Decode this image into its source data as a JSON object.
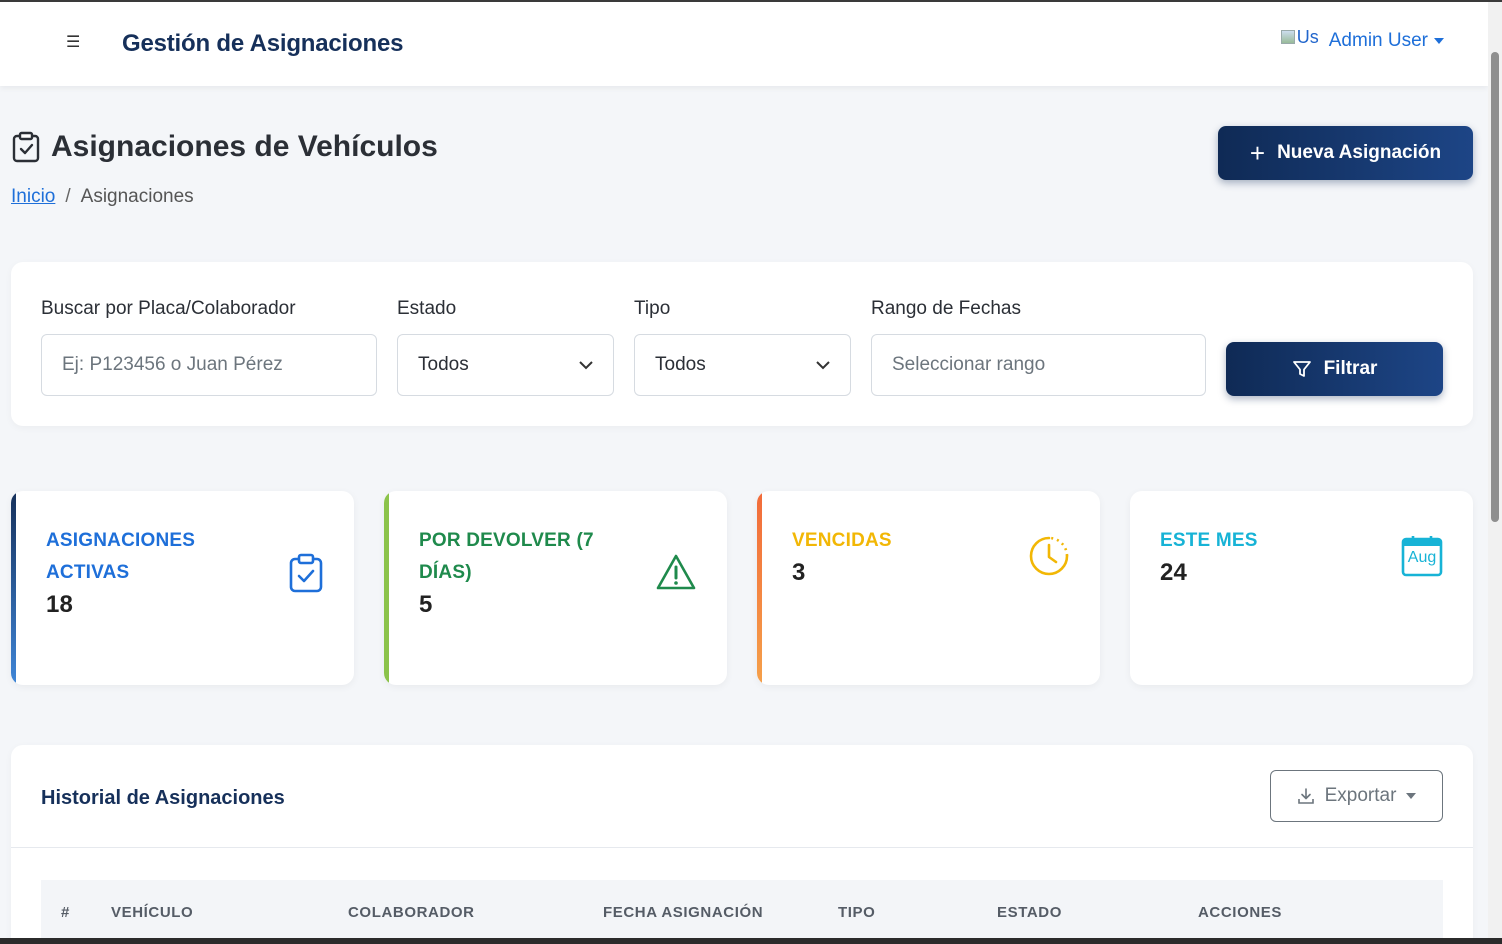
{
  "topbar": {
    "menu_icon": "hamburger-icon",
    "app_title": "Gestión de Asignaciones",
    "avatar_alt": "Us",
    "user_name": "Admin User"
  },
  "page": {
    "title": "Asignaciones de Vehículos",
    "title_icon": "clipboard-check-icon",
    "breadcrumb": {
      "home": "Inicio",
      "current": "Asignaciones"
    },
    "new_button": "Nueva Asignación"
  },
  "filters": {
    "search": {
      "label": "Buscar por Placa/Colaborador",
      "placeholder": "Ej: P123456 o Juan Pérez"
    },
    "estado": {
      "label": "Estado",
      "value": "Todos"
    },
    "tipo": {
      "label": "Tipo",
      "value": "Todos"
    },
    "fechas": {
      "label": "Rango de Fechas",
      "placeholder": "Seleccionar rango"
    },
    "filter_button": "Filtrar"
  },
  "stats": [
    {
      "label": "ASIGNACIONES ACTIVAS",
      "value": "18",
      "color": "#1e6fd9",
      "icon": "clipboard-check-icon"
    },
    {
      "label": "POR DEVOLVER (7 DÍAS)",
      "value": "5",
      "color": "#1f8a4c",
      "icon": "warning-triangle-icon"
    },
    {
      "label": "VENCIDAS",
      "value": "3",
      "color": "#f2b705",
      "icon": "clock-icon"
    },
    {
      "label": "ESTE MES",
      "value": "24",
      "color": "#17b3d6",
      "icon": "calendar-icon",
      "icon_text": "Aug"
    }
  ],
  "history": {
    "title": "Historial de Asignaciones",
    "export_button": "Exportar",
    "columns": [
      "#",
      "VEHÍCULO",
      "COLABORADOR",
      "FECHA ASIGNACIÓN",
      "TIPO",
      "ESTADO",
      "ACCIONES"
    ]
  }
}
